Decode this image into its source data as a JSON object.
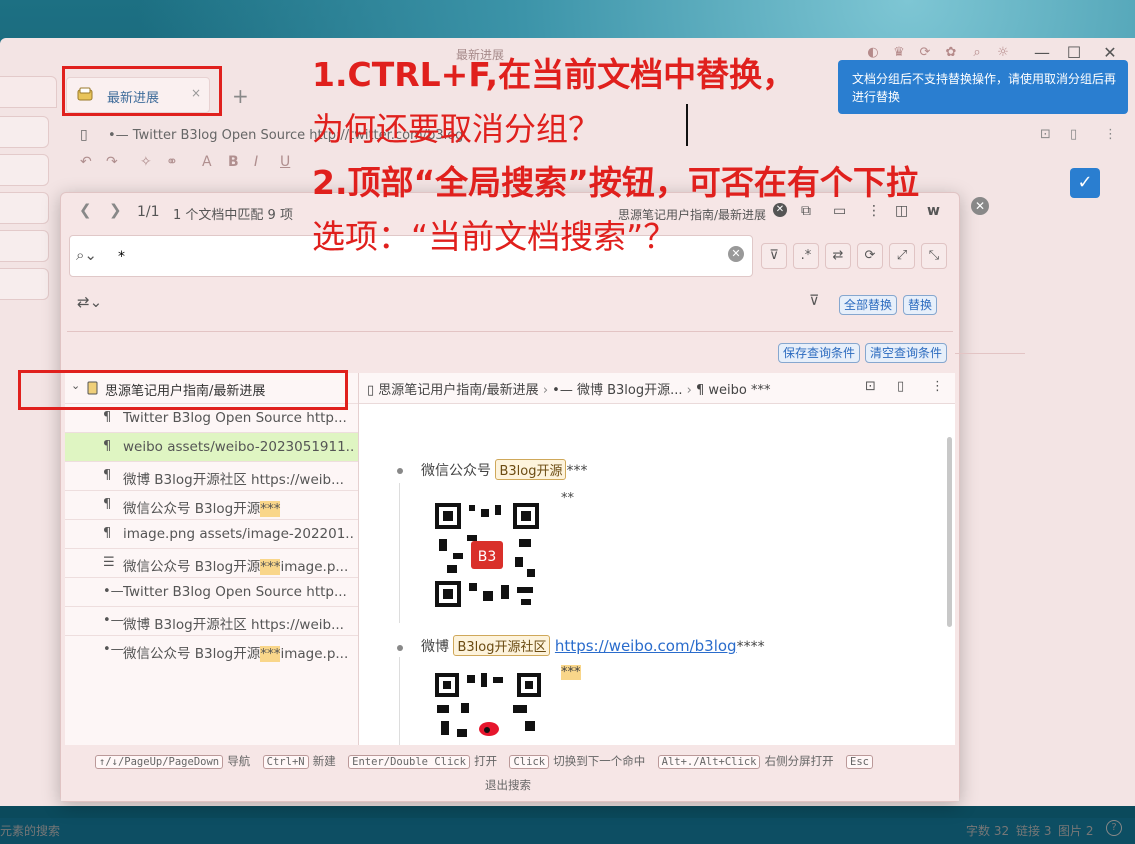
{
  "window": {
    "title": "最新进展"
  },
  "tab": {
    "label": "最新进展",
    "close": "×",
    "add": "+"
  },
  "editor": {
    "breadcrumb": "•— Twitter B3log Open Source http://twitter.com/b3log"
  },
  "search": {
    "counter": "1/1",
    "summary": "1 个文档中匹配 9 项",
    "path": "思源笔记用户指南/最新进展",
    "query": "*",
    "replace_all": "全部替换",
    "replace": "替换",
    "save_query": "保存查询条件",
    "clear_query": "清空查询条件",
    "results": {
      "group": "思源笔记用户指南/最新进展",
      "items": [
        {
          "icon": "¶",
          "pre": "Twitter B3log Open Source http...",
          "hl": "",
          "post": ""
        },
        {
          "icon": "¶",
          "pre": "weibo assets/weibo-2023051911...",
          "hl": "",
          "post": ""
        },
        {
          "icon": "¶",
          "pre": "微博 B3log开源社区 https://weib...",
          "hl": "",
          "post": ""
        },
        {
          "icon": "¶",
          "pre": "微信公众号 B3log开源",
          "hl": "***",
          "post": ""
        },
        {
          "icon": "¶",
          "pre": "image.png assets/image-202201...",
          "hl": "",
          "post": ""
        },
        {
          "icon": "☰",
          "pre": "微信公众号 B3log开源",
          "hl": "***",
          "post": "image.p..."
        },
        {
          "icon": "•—",
          "pre": "Twitter B3log Open Source http...",
          "hl": "",
          "post": ""
        },
        {
          "icon": "•—",
          "pre": "微博 B3log开源社区 https://weib...",
          "hl": "",
          "post": ""
        },
        {
          "icon": "•—",
          "pre": "微信公众号 B3log开源",
          "hl": "***",
          "post": "image.p..."
        }
      ]
    },
    "preview": {
      "crumb1": "思源笔记用户指南/最新进展",
      "crumb2": "•— 微博 B3log开源...",
      "crumb3": "¶ weibo ***",
      "item1_label": "微信公众号",
      "item1_tag": "B3log开源",
      "item1_suffix": "***",
      "item1_after": "**",
      "item2_label": "微博",
      "item2_tag": "B3log开源社区",
      "item2_link": "https://weibo.com/b3log",
      "item2_suffix": "****",
      "item2_after": "***"
    },
    "footer": {
      "k1": "↑/↓/PageUp/PageDown",
      "t1": "导航",
      "k2": "Ctrl+N",
      "t2": "新建",
      "k3": "Enter/Double Click",
      "t3": "打开",
      "k4": "Click",
      "t4": "切换到下一个命中",
      "k5": "Alt+./Alt+Click",
      "t5": "右侧分屏打开",
      "k6": "Esc",
      "t6": "退出搜索"
    }
  },
  "toast": {
    "text": "文档分组后不支持替换操作，请使用取消分组后再进行替换"
  },
  "statusbar": {
    "left": "元素的搜索",
    "words": "字数 32",
    "links": "链接 3",
    "images": "图片 2",
    "help": "?"
  },
  "annotations": {
    "line1": "1.CTRL+F,在当前文档中替换，",
    "line2": "为何还要取消分组？",
    "line3": "2.顶部“全局搜索”按钮，可否在有个下拉",
    "line4": "选项：“当前文档搜索”？"
  },
  "colors": {
    "annotation": "#e0201d",
    "accent": "#2a7ed0",
    "highlight": "#f9d68a"
  }
}
